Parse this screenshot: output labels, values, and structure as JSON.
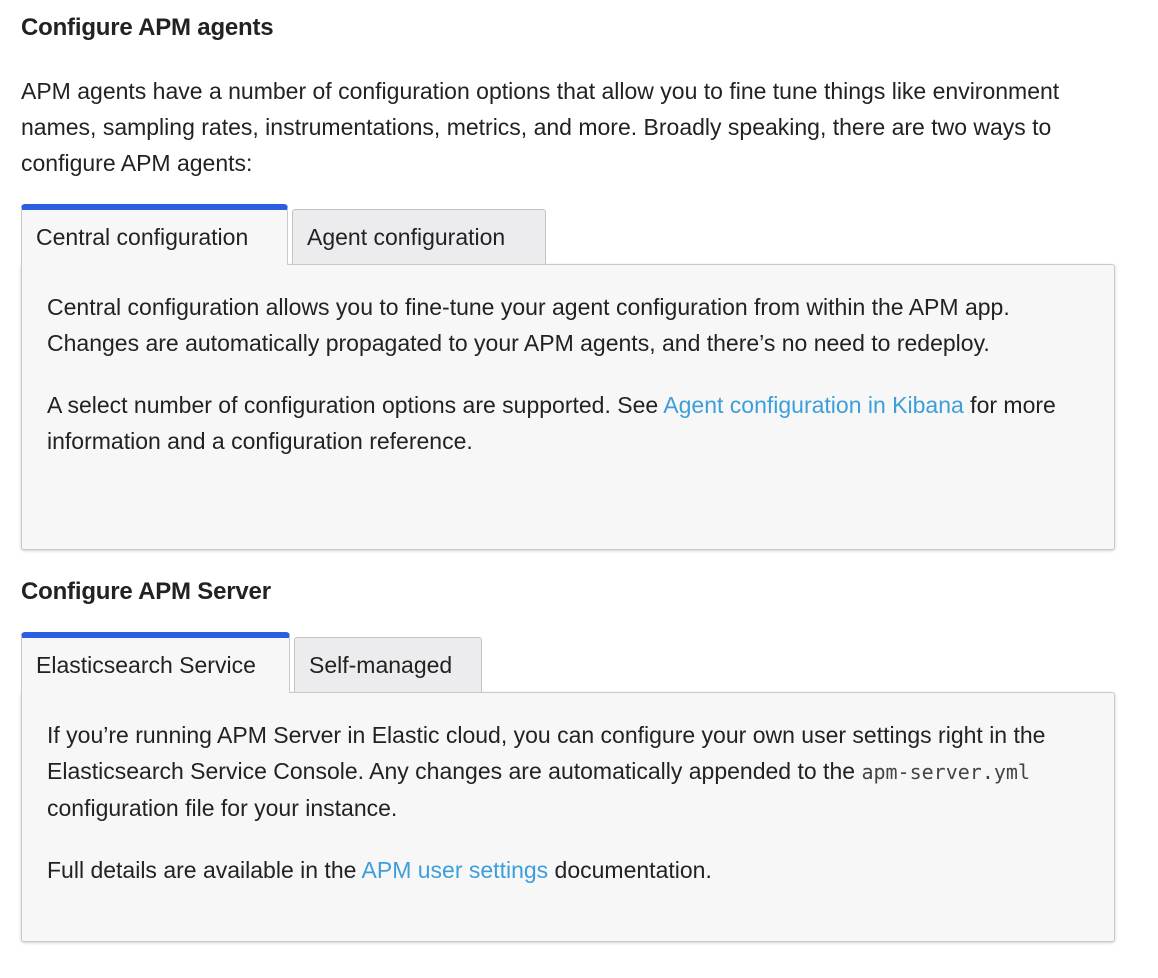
{
  "agents_section": {
    "title": "Configure APM agents",
    "intro": "APM agents have a number of configuration options that allow you to fine tune things like environment names, sampling rates, instrumentations, metrics, and more. Broadly speaking, there are two ways to configure APM agents:",
    "tabs": [
      {
        "label": "Central configuration",
        "active": true
      },
      {
        "label": "Agent configuration",
        "active": false
      }
    ],
    "panel": {
      "paragraph1": "Central configuration allows you to fine-tune your agent configuration from within the APM app. Changes are automatically propagated to your APM agents, and there’s no need to redeploy.",
      "paragraph2_before": "A select number of configuration options are supported. See ",
      "paragraph2_link": "Agent configuration in Kibana",
      "paragraph2_after": " for more information and a configuration reference."
    }
  },
  "server_section": {
    "title": "Configure APM Server",
    "tabs": [
      {
        "label": "Elasticsearch Service",
        "active": true
      },
      {
        "label": "Self-managed",
        "active": false
      }
    ],
    "panel": {
      "paragraph1_before": "If you’re running APM Server in Elastic cloud, you can configure your own user settings right in the Elasticsearch Service Console. Any changes are automatically appended to the ",
      "paragraph1_code": "apm-server.yml",
      "paragraph1_after": " configuration file for your instance.",
      "paragraph2_before": "Full details are available in the ",
      "paragraph2_link": "APM user settings",
      "paragraph2_after": " documentation."
    }
  },
  "colors": {
    "active_tab_accent": "#2b5fe0",
    "link": "#3c9fd9",
    "panel_background": "#f7f7f8",
    "inactive_tab_background": "#ececee"
  }
}
